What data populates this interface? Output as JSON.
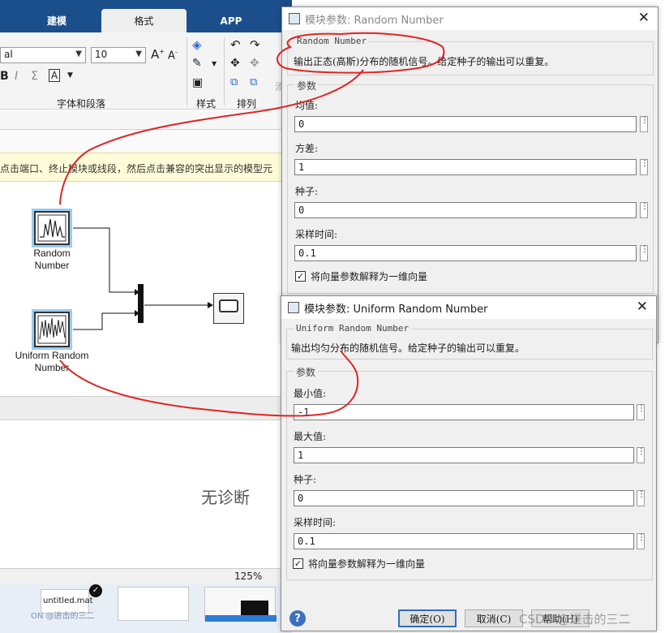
{
  "ribbon": {
    "tabs": [
      "建模",
      "格式",
      "APP"
    ],
    "font_name": "al",
    "font_size": "10",
    "group_font": "字体和段落",
    "group_style": "样式",
    "group_arrange": "排列",
    "group_fill": "添"
  },
  "hint": {
    "text": "点击端口、终止模块或线段，然后点击兼容的突出显示的模型元"
  },
  "canvas": {
    "blocks": [
      {
        "label_line1": "Random",
        "label_line2": "Number"
      },
      {
        "label_line1": "Uniform Random",
        "label_line2": "Number"
      }
    ]
  },
  "diagnostics": {
    "text": "无诊断"
  },
  "statusbar": {
    "zoom": "125%"
  },
  "taskbar": {
    "thumb_label": "untitled.mat",
    "thumb_sub": "ON @进击的三二"
  },
  "dialog_random": {
    "title": "模块参数: Random Number",
    "block_type": "Random Number",
    "description": "输出正态(高斯)分布的随机信号。给定种子的输出可以重复。",
    "params_legend": "参数",
    "params": [
      {
        "label": "均值:",
        "value": "0"
      },
      {
        "label": "方差:",
        "value": "1"
      },
      {
        "label": "种子:",
        "value": "0"
      },
      {
        "label": "采样时间:",
        "value": "0.1"
      }
    ],
    "checkbox_label": "将向量参数解释为一维向量"
  },
  "dialog_uniform": {
    "title": "模块参数: Uniform Random Number",
    "block_type": "Uniform Random Number",
    "description": "输出均匀分布的随机信号。给定种子的输出可以重复。",
    "params_legend": "参数",
    "params": [
      {
        "label": "最小值:",
        "value": "-1"
      },
      {
        "label": "最大值:",
        "value": "1"
      },
      {
        "label": "种子:",
        "value": "0"
      },
      {
        "label": "采样时间:",
        "value": "0.1"
      }
    ],
    "checkbox_label": "将向量参数解释为一维向量",
    "ok_label": "确定(O)",
    "cancel_label": "取消(C)",
    "help_label": "帮助(H)"
  },
  "watermark": "CSDN @进击的三二",
  "colors": {
    "tab_blue": "#1b4f8b",
    "annotation_red": "#e02424",
    "select_blue": "#9bcbf2"
  }
}
